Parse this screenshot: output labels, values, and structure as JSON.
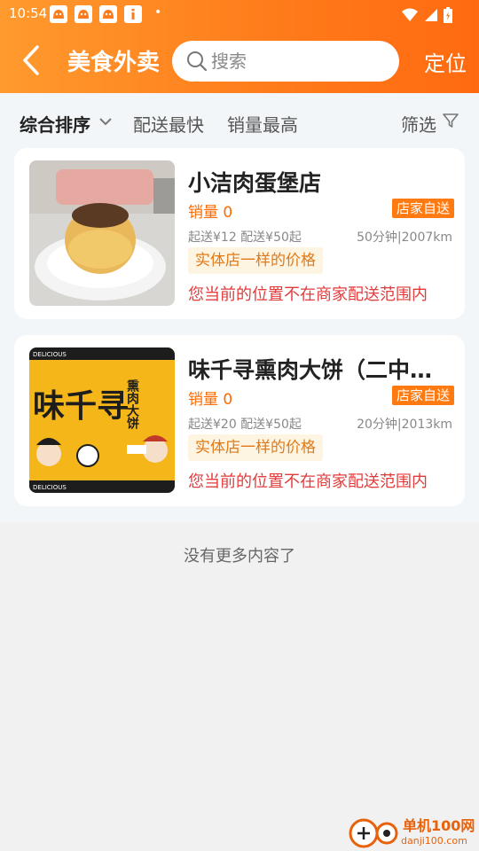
{
  "status_bar": {
    "time": "10:54",
    "dot": "•",
    "icons": [
      "app-icon",
      "app-icon",
      "app-icon",
      "info-app-icon",
      "wifi-icon",
      "signal-icon",
      "battery-icon"
    ]
  },
  "header": {
    "title": "美食外卖",
    "search_placeholder": "搜索",
    "locate_label": "定位",
    "colors": {
      "gradient_start": "#ff9a2e",
      "gradient_end": "#ff6a10"
    }
  },
  "filters": {
    "tabs": [
      {
        "label": "综合排序",
        "active": true
      },
      {
        "label": "配送最快",
        "active": false
      },
      {
        "label": "销量最高",
        "active": false
      }
    ],
    "filter_label": "筛选"
  },
  "shops": [
    {
      "name": "小洁肉蛋堡店",
      "sales": "销量 0",
      "badge": "店家自送",
      "fees": "起送¥12 配送¥50起",
      "distance": "50分钟|2007km",
      "promo": "实体店一样的价格",
      "warning": "您当前的位置不在商家配送范围内"
    },
    {
      "name": "味千寻熏肉大饼（二中…",
      "sales": "销量 0",
      "badge": "店家自送",
      "fees": "起送¥20 配送¥50起",
      "distance": "20分钟|2013km",
      "promo": "实体店一样的价格",
      "warning": "您当前的位置不在商家配送范围内",
      "banner_text": "味千寻",
      "banner_side": "熏肉大饼",
      "banner_strip": "DELICIOUS"
    }
  ],
  "footer": {
    "no_more": "没有更多内容了"
  },
  "watermark": {
    "title": "单机100网",
    "url": "danji100.com"
  },
  "colors": {
    "accent": "#ff7a10",
    "warning": "#e23b3b",
    "sales": "#ff6a00"
  }
}
